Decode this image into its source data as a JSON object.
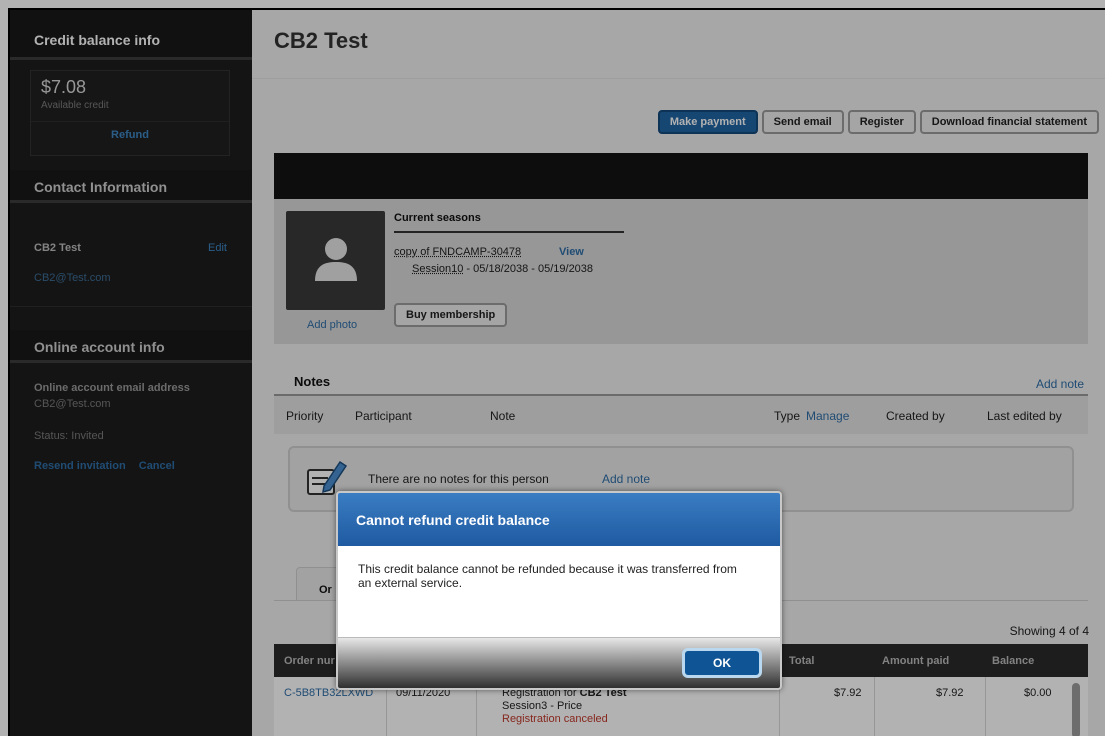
{
  "sidebar": {
    "credit_header": "Credit balance info",
    "credit_amount": "$7.08",
    "credit_sub": "Available credit",
    "refund_label": "Refund",
    "contact_header": "Contact Information",
    "contact_name": "CB2 Test",
    "edit_label": "Edit",
    "contact_email": "CB2@Test.com",
    "online_header": "Online account info",
    "oa_email_label": "Online account email address",
    "oa_email": "CB2@Test.com",
    "oa_status": "Status: Invited",
    "resend_label": "Resend invitation",
    "cancel_label": "Cancel"
  },
  "main": {
    "title": "CB2 Test",
    "buttons": {
      "make_payment": "Make payment",
      "send_email": "Send email",
      "register": "Register",
      "download": "Download financial statement"
    },
    "profile": {
      "add_photo": "Add photo",
      "seasons_title": "Current seasons",
      "season_name": "copy of FNDCAMP-30478",
      "view_label": "View",
      "session_name": "Session10",
      "session_dates": " - 05/18/2038 - 05/19/2038",
      "buy_membership": "Buy membership"
    },
    "notes": {
      "title": "Notes",
      "add_note": "Add note",
      "columns": {
        "priority": "Priority",
        "participant": "Participant",
        "note": "Note",
        "type": "Type",
        "manage": "Manage",
        "created_by": "Created by",
        "last_edited_by": "Last edited by"
      },
      "empty_text": "There are no notes for this person",
      "empty_add": "Add note"
    },
    "orders": {
      "tab_label": "Or",
      "showing": "Showing 4 of 4",
      "columns": {
        "order_num": "Order nur",
        "total": "Total",
        "amount_paid": "Amount paid",
        "balance": "Balance"
      },
      "row": {
        "order_id": "C-5B8TB32LXWD",
        "date": "09/11/2020",
        "desc_prefix": "Registration for ",
        "desc_name": "CB2 Test",
        "desc_line2": "Session3 - Price",
        "desc_status": "Registration canceled",
        "total": "$7.92",
        "amount_paid": "$7.92",
        "balance": "$0.00"
      }
    }
  },
  "modal": {
    "title": "Cannot refund credit balance",
    "body": "This credit balance cannot be refunded because it was transferred from an external service.",
    "ok_label": "OK"
  },
  "colors": {
    "accent": "#2065a4",
    "link": "#2e6ea7",
    "sidebar_bg": "#1e1e1e",
    "danger": "#c0392b"
  }
}
